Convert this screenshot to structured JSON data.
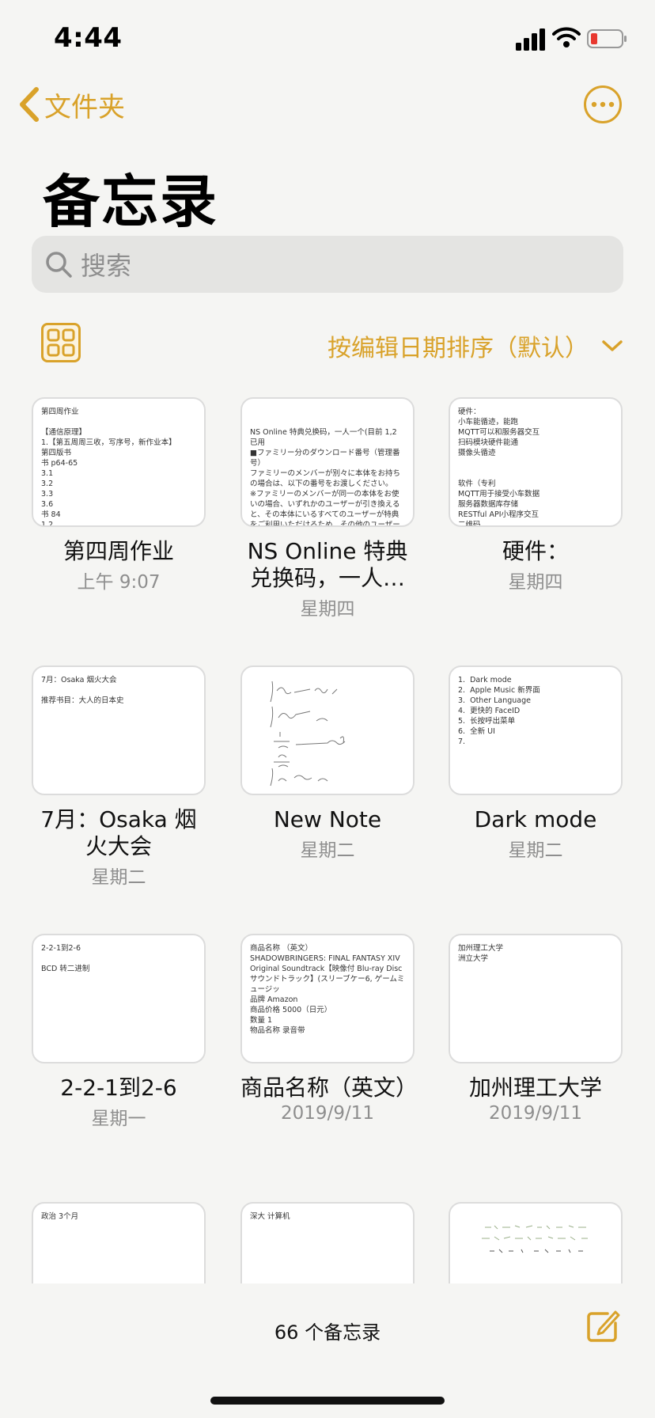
{
  "status_bar": {
    "time": "4:44"
  },
  "nav": {
    "back_label": "文件夹"
  },
  "header": {
    "title": "备忘录"
  },
  "search": {
    "placeholder": "搜索"
  },
  "sort": {
    "label": "按编辑日期排序（默认）"
  },
  "notes": [
    {
      "title": "第四周作业",
      "date": "上午 9:07",
      "preview": "第四周作业\n\n【通信原理】\n1.【第五周周三收，写序号，新作业本】\n第四版书\n书 p64-65\n3.1\n3.2\n3.3\n3.6\n书 84\n1.2"
    },
    {
      "title": "NS Online 特典兑换码，一人…",
      "date": "星期四",
      "preview": "\n\nNS Online 特典兑换码，一人一个(目前 1,2 已用\n■ファミリー分のダウンロード番号（管理番号）\nファミリーのメンバーが別々に本体をお持ちの場合は、以下の番号をお渡しください。\n※ファミリーのメンバーが同一の本体をお使いの場合、いずれかのユーザーが引き換えると、その本体にいるすべてのユーザーが特典をご利用いただけるため、その他のユーザーは番号を使えません。"
    },
    {
      "title": "硬件：",
      "date": "星期四",
      "preview": "硬件：\n小车能循迹，能跑\nMQTT可以和服务器交互\n扫码模块硬件能通\n摄像头循迹\n\n\n软件（专利\nMQTT用于接受小车数据\n服务器数据库存储\nRESTful API小程序交互\n二维码……"
    },
    {
      "title": "7月：Osaka 烟火大会",
      "date": "星期二",
      "preview": "7月：Osaka 烟火大会\n\n推荐书目：大人的日本史"
    },
    {
      "title": "New Note",
      "date": "星期二",
      "preview": ""
    },
    {
      "title": "Dark mode",
      "date": "星期二",
      "preview": "1.  Dark mode\n2.  Apple Music 新界面\n3.  Other Language\n4.  更快的 FaceID\n5.  长按呼出菜单\n6.  全新 UI\n7."
    },
    {
      "title": "2-2-1到2-6",
      "date": "星期一",
      "preview": "2-2-1到2-6\n\nBCD 转二进制"
    },
    {
      "title": "商品名称（英文）",
      "date": "2019/9/11",
      "preview": "商品名称 （英文）\nSHADOWBRINGERS: FINAL FANTASY XIV Original Soundtrack【映像付 Blu-ray Disc サウンドトラック】(スリーブケー6, ゲームミュージッ\n品牌 Amazon\n商品价格 5000（日元）\n数量 1\n物品名称 录音带"
    },
    {
      "title": "加州理工大学",
      "date": "2019/9/11",
      "preview": "加州理工大学\n洲立大学"
    },
    {
      "title": "",
      "date": "",
      "preview": "政治 3个月"
    },
    {
      "title": "",
      "date": "",
      "preview": "深大 计算机"
    },
    {
      "title": "",
      "date": "",
      "preview": ""
    }
  ],
  "footer": {
    "count": "66 个备忘录"
  },
  "colors": {
    "accent": "#d9a22a",
    "background": "#f5f5f3",
    "secondary_text": "#8e8e8e"
  }
}
